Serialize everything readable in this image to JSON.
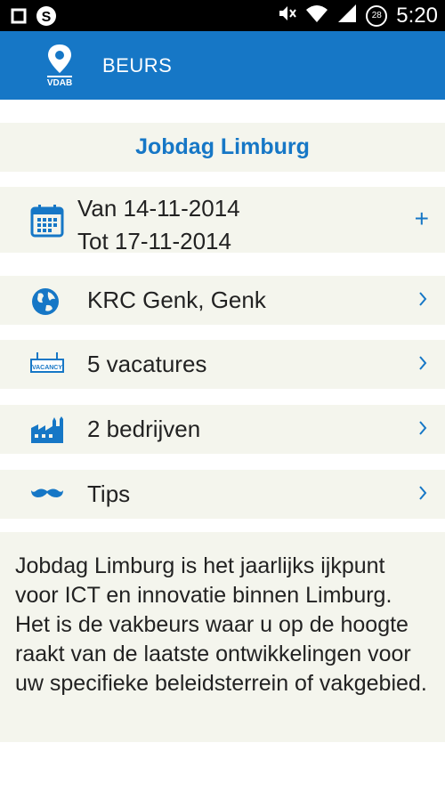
{
  "status_bar": {
    "time": "5:20",
    "battery_level": "28",
    "icons": [
      "square-icon",
      "app-s-icon",
      "mute-icon",
      "wifi-icon",
      "signal-icon",
      "battery-icon"
    ]
  },
  "app_bar": {
    "logo_text": "VDAB",
    "title": "BEURS",
    "color": "#1677c6"
  },
  "event": {
    "title": "Jobdag Limburg",
    "date_from": "Van 14-11-2014",
    "date_to": "Tot 17-11-2014",
    "add_symbol": "+",
    "rows": [
      {
        "label": "KRC Genk, Genk",
        "icon": "globe-icon"
      },
      {
        "label": "5 vacatures",
        "icon": "vacancy-icon"
      },
      {
        "label": "2 bedrijven",
        "icon": "factory-icon"
      },
      {
        "label": "Tips",
        "icon": "mustache-icon"
      }
    ],
    "description": "Jobdag Limburg is het jaarlijks ijkpunt voor ICT en innovatie binnen Limburg. Het is de vakbeurs waar u op de hoogte raakt van de laatste ontwikkelingen voor uw specifieke beleidsterrein of vakgebied."
  }
}
